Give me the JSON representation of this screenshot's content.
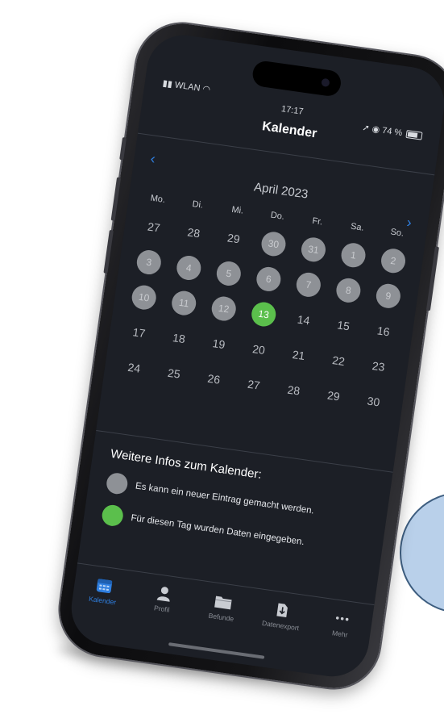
{
  "status_bar": {
    "signal": "WLAN",
    "time": "17:17",
    "battery": "74 %"
  },
  "header": {
    "title": "Kalender"
  },
  "calendar": {
    "month_label": "April 2023",
    "weekdays": [
      "Mo.",
      "Di.",
      "Mi.",
      "Do.",
      "Fr.",
      "Sa.",
      "So."
    ],
    "weeks": [
      [
        {
          "n": "27",
          "s": "plain"
        },
        {
          "n": "28",
          "s": "plain"
        },
        {
          "n": "29",
          "s": "plain"
        },
        {
          "n": "30",
          "s": "grey"
        },
        {
          "n": "31",
          "s": "grey"
        },
        {
          "n": "1",
          "s": "grey"
        },
        {
          "n": "2",
          "s": "grey"
        }
      ],
      [
        {
          "n": "3",
          "s": "grey"
        },
        {
          "n": "4",
          "s": "grey"
        },
        {
          "n": "5",
          "s": "grey"
        },
        {
          "n": "6",
          "s": "grey"
        },
        {
          "n": "7",
          "s": "grey"
        },
        {
          "n": "8",
          "s": "grey"
        },
        {
          "n": "9",
          "s": "grey"
        }
      ],
      [
        {
          "n": "10",
          "s": "grey"
        },
        {
          "n": "11",
          "s": "grey"
        },
        {
          "n": "12",
          "s": "grey"
        },
        {
          "n": "13",
          "s": "green"
        },
        {
          "n": "14",
          "s": "plain"
        },
        {
          "n": "15",
          "s": "plain"
        },
        {
          "n": "16",
          "s": "plain"
        }
      ],
      [
        {
          "n": "17",
          "s": "plain"
        },
        {
          "n": "18",
          "s": "plain"
        },
        {
          "n": "19",
          "s": "plain"
        },
        {
          "n": "20",
          "s": "plain"
        },
        {
          "n": "21",
          "s": "plain"
        },
        {
          "n": "22",
          "s": "plain"
        },
        {
          "n": "23",
          "s": "plain"
        }
      ],
      [
        {
          "n": "24",
          "s": "plain"
        },
        {
          "n": "25",
          "s": "plain"
        },
        {
          "n": "26",
          "s": "plain"
        },
        {
          "n": "27",
          "s": "plain"
        },
        {
          "n": "28",
          "s": "plain"
        },
        {
          "n": "29",
          "s": "plain"
        },
        {
          "n": "30",
          "s": "plain"
        }
      ]
    ]
  },
  "info": {
    "title": "Weitere Infos zum Kalender:",
    "legend": [
      {
        "color": "#8e9196",
        "text": "Es kann ein neuer Eintrag gemacht werden."
      },
      {
        "color": "#5bbf4c",
        "text": "Für diesen Tag wurden Daten eingegeben."
      }
    ]
  },
  "tabs": [
    {
      "label": "Kalender",
      "icon": "calendar-icon",
      "active": true
    },
    {
      "label": "Profil",
      "icon": "person-icon",
      "active": false
    },
    {
      "label": "Befunde",
      "icon": "folder-icon",
      "active": false
    },
    {
      "label": "Datenexport",
      "icon": "export-icon",
      "active": false
    },
    {
      "label": "Mehr",
      "icon": "more-icon",
      "active": false
    }
  ],
  "colors": {
    "accent": "#2f7fe0",
    "entry_available": "#8e9196",
    "data_entered": "#5bbf4c",
    "screen_bg": "#1c1f26"
  }
}
